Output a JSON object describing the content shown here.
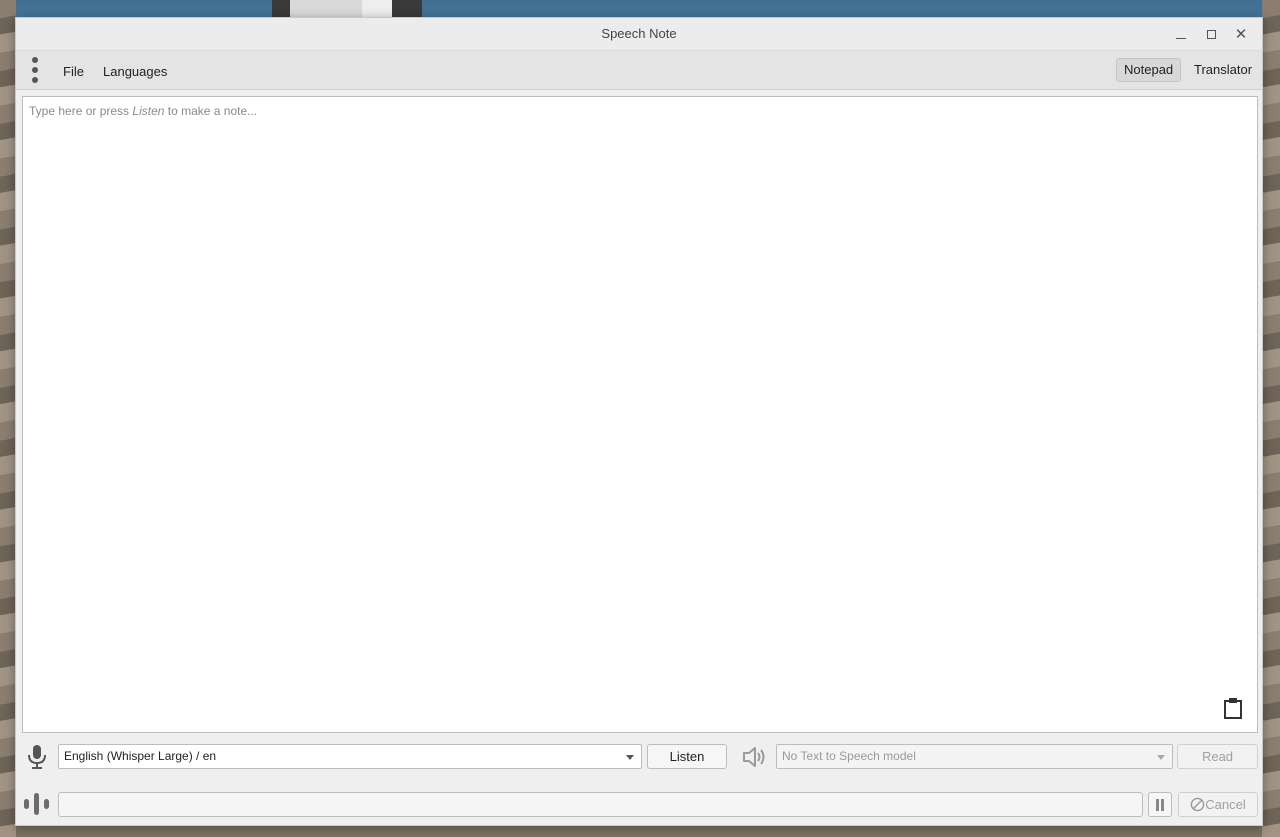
{
  "window": {
    "title": "Speech Note"
  },
  "menu": {
    "items": [
      {
        "label": "File"
      },
      {
        "label": "Languages"
      }
    ]
  },
  "modes": {
    "notepad": "Notepad",
    "translator": "Translator",
    "active": "Notepad"
  },
  "editor": {
    "placeholder_before": "Type here or press ",
    "placeholder_emphasis": "Listen",
    "placeholder_after": " to make a note...",
    "value": ""
  },
  "stt": {
    "model_selected": "English (Whisper Large) / en",
    "listen_label": "Listen"
  },
  "tts": {
    "model_selected": "No Text to Speech model",
    "read_label": "Read"
  },
  "status": {
    "progress": 0,
    "cancel_label": "Cancel"
  },
  "icons": {
    "menu": "kebab-menu-icon",
    "microphone": "microphone-icon",
    "speaker": "speaker-icon",
    "audio_level": "audio-level-icon",
    "pause": "pause-icon",
    "cancel": "cancel-icon",
    "clipboard": "clipboard-icon"
  },
  "colors": {
    "window_bg": "#efefef",
    "active_tab_bg": "#d8d8d8",
    "editor_bg": "#ffffff"
  }
}
